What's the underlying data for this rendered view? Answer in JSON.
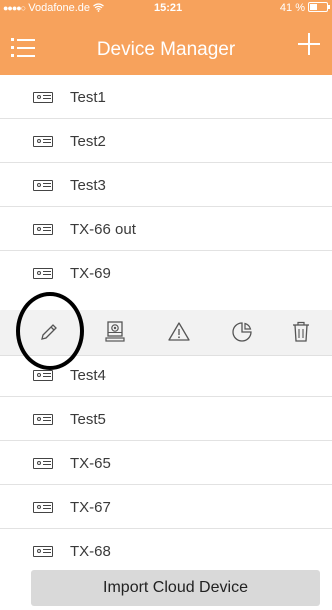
{
  "status_bar": {
    "signal_dots": "●●●●○",
    "carrier": "Vodafone.de",
    "wifi_icon": "wifi-icon",
    "time": "15:21",
    "battery": "41 %"
  },
  "navbar": {
    "title": "Device Manager",
    "menu_icon": "list-icon",
    "add_icon": "plus-icon"
  },
  "devices": [
    {
      "label": "Test1"
    },
    {
      "label": "Test2"
    },
    {
      "label": "Test3"
    },
    {
      "label": "TX-66 out"
    },
    {
      "label": "TX-69"
    },
    {
      "label": "Test4"
    },
    {
      "label": "Test5"
    },
    {
      "label": "TX-65"
    },
    {
      "label": "TX-67"
    },
    {
      "label": "TX-68"
    }
  ],
  "actions": [
    "edit-pencil-icon",
    "device-settings-icon",
    "warning-icon",
    "pie-chart-icon",
    "trash-icon"
  ],
  "bottom": {
    "import_label": "Import Cloud Device"
  },
  "colors": {
    "accent": "#f7a25c",
    "action_bar": "#f2f2f2",
    "import_button": "#d9d9d9"
  }
}
